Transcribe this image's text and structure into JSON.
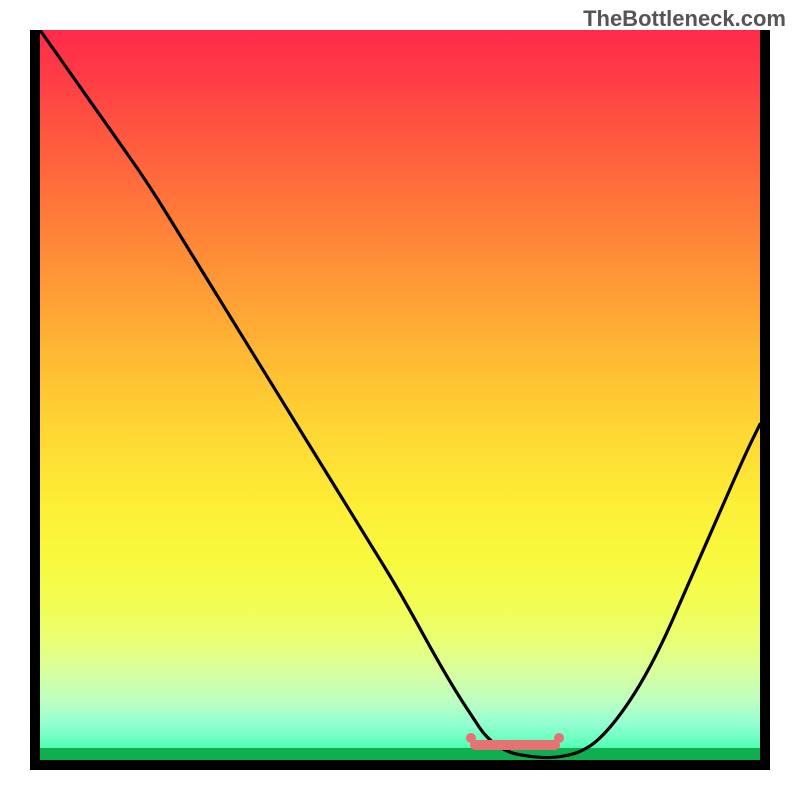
{
  "watermark": "TheBottleneck.com",
  "chart_data": {
    "type": "line",
    "title": "",
    "xlabel": "",
    "ylabel": "",
    "xlim": [
      0,
      100
    ],
    "ylim": [
      0,
      100
    ],
    "x": [
      0,
      5,
      10,
      15,
      20,
      25,
      30,
      35,
      40,
      45,
      50,
      55,
      58,
      60,
      62,
      65,
      68,
      70,
      72,
      75,
      78,
      82,
      86,
      90,
      94,
      98,
      100
    ],
    "values": [
      100,
      93,
      86,
      79,
      71,
      63,
      55,
      47,
      39,
      31,
      23,
      14,
      9,
      6,
      3,
      1,
      0.5,
      0.3,
      0.4,
      1,
      3,
      8,
      15,
      24,
      33,
      42,
      46
    ],
    "highlight_band": {
      "x_start": 60,
      "x_end": 72,
      "y": 2
    },
    "annotations": []
  },
  "colors": {
    "curve": "#000000",
    "highlight": "#e57373",
    "frame": "#000000"
  }
}
